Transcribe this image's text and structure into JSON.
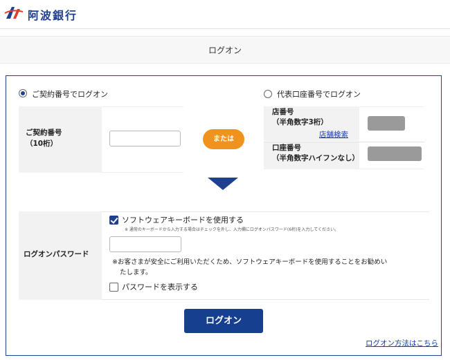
{
  "header": {
    "logo_text": "阿波銀行"
  },
  "title": "ログオン",
  "contract_option": {
    "radio_label": "ご契約番号でログオン",
    "selected": true,
    "field_label_line1": "ご契約番号",
    "field_label_line2": "（10桁）",
    "input_value": ""
  },
  "or_label": "または",
  "account_option": {
    "radio_label": "代表口座番号でログオン",
    "selected": false,
    "branch_label_line1": "店番号",
    "branch_label_line2": "（半角数字3桁）",
    "branch_search_link": "店舗検索",
    "account_label_line1": "口座番号",
    "account_label_line2": "（半角数字ハイフンなし）"
  },
  "password": {
    "label": "ログオンパスワード",
    "software_keyboard_label": "ソフトウェアキーボードを使用する",
    "software_keyboard_checked": true,
    "note_small": "※ 通常のキーボードから入力する場合はチェックを外し、入力欄にログオンパスワード(6桁)を入力してください。",
    "input_value": "",
    "note_line1": "※お客さまが安全にご利用いただくため、ソフトウェアキーボードを使用することをお勧めい",
    "note_line2": "たします。",
    "show_password_label": "パスワードを表示する",
    "show_password_checked": false
  },
  "logon_button": "ログオン",
  "help_link": "ログオン方法はこちら",
  "colors": {
    "brand": "#1f3f8f",
    "accent": "#f0921e",
    "button": "#163f8f"
  }
}
